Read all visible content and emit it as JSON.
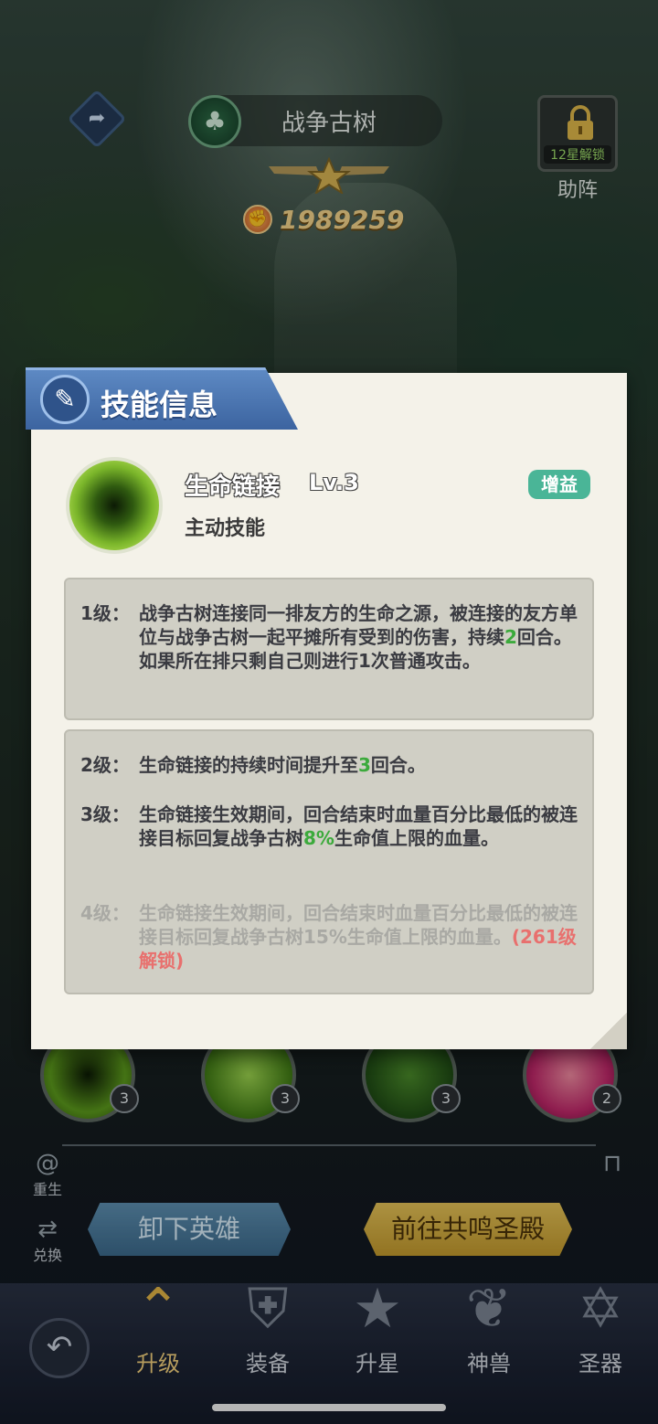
{
  "header": {
    "hero_name": "战争古树",
    "faction_icon": "tree-icon",
    "power_value": "1989259",
    "assist_unlock": "12星解锁",
    "assist_label": "助阵"
  },
  "modal": {
    "title": "技能信息",
    "skill_name": "生命链接",
    "skill_level": "Lv.3",
    "skill_type": "主动技能",
    "badge": "增益",
    "levels": [
      {
        "label": "1级：",
        "text_a": "战争古树连接同一排友方的生命之源，被连接的友方单位与战争古树一起平摊所有受到的伤害，持续",
        "num": "2",
        "text_b": "回合。如果所在排只剩自己则进行1次普通攻击。"
      },
      {
        "label": "2级：",
        "text_a": "生命链接的持续时间提升至",
        "num": "3",
        "text_b": "回合。"
      },
      {
        "label": "3级：",
        "text_a": "生命链接生效期间，回合结束时血量百分比最低的被连接目标回复战争古树",
        "num": "8%",
        "text_b": "生命值上限的血量。"
      },
      {
        "label": "4级：",
        "text_a": "生命链接生效期间，回合结束时血量百分比最低的被连接目标回复战争古树15%生命值上限的血量。",
        "lock_note": "(261级解锁)"
      }
    ]
  },
  "skill_slots": [
    {
      "level": "3"
    },
    {
      "level": "3"
    },
    {
      "level": "3"
    },
    {
      "level": "2"
    }
  ],
  "side_actions": {
    "rebirth": "重生",
    "exchange": "兑换"
  },
  "buttons": {
    "remove_hero": "卸下英雄",
    "go_resonance": "前往共鸣圣殿"
  },
  "nav": {
    "upgrade": "升级",
    "equip": "装备",
    "star_up": "升星",
    "beast": "神兽",
    "artifact": "圣器"
  },
  "colors": {
    "modal_bg": "#f4f2e9",
    "tab_blue": "#4a74b0",
    "badge_green": "#4ab597",
    "highlight_green": "#3caa3c",
    "lock_red": "#e8706e",
    "power_gold": "#f4d58b"
  }
}
